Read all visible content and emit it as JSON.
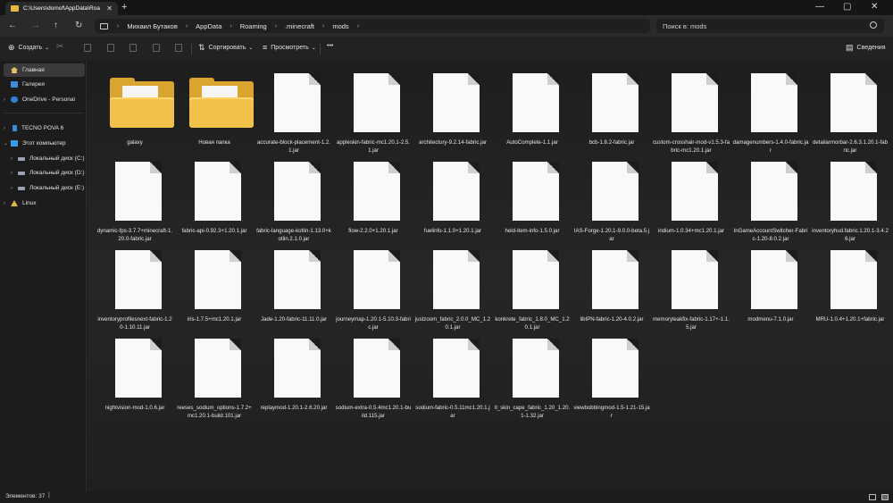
{
  "window": {
    "tab_title": "C:\\Users\\domof\\AppData\\Roa",
    "controls": {
      "minimize": "—",
      "maximize": "▢",
      "close": "✕"
    }
  },
  "address": {
    "breadcrumb": [
      "Михаил Бутаков",
      "AppData",
      "Roaming",
      ".minecraft",
      "mods"
    ],
    "search_placeholder": "Поиск в: mods"
  },
  "toolbar": {
    "create_label": "Создать",
    "sort_label": "Сортировать",
    "view_label": "Просмотреть",
    "more_label": "•••",
    "details_label": "Сведения"
  },
  "sidebar": {
    "items": [
      {
        "label": "Главная",
        "icon": "home-icon",
        "selected": true
      },
      {
        "label": "Галерея",
        "icon": "gallery-icon",
        "selected": false
      },
      {
        "label": "OneDrive - Personal",
        "icon": "cloud-icon",
        "selected": false
      },
      {
        "label": "TECNO POVA 6",
        "icon": "phone-icon",
        "selected": false
      },
      {
        "label": "Этот компьютер",
        "icon": "computer-icon",
        "selected": false
      },
      {
        "label": "Локальный диск (C:)",
        "icon": "drive-icon",
        "selected": false
      },
      {
        "label": "Локальный диск (D:)",
        "icon": "drive-icon",
        "selected": false
      },
      {
        "label": "Локальный диск (E:)",
        "icon": "drive-icon",
        "selected": false
      },
      {
        "label": "Linux",
        "icon": "linux-icon",
        "selected": false
      }
    ]
  },
  "files": [
    {
      "name": "galaxy",
      "type": "folder"
    },
    {
      "name": "Новая папка",
      "type": "folder"
    },
    {
      "name": "accurate-block-placement-1.2.1.jar",
      "type": "file"
    },
    {
      "name": "appleskin-fabric-mc1.20.1-2.5.1.jar",
      "type": "file"
    },
    {
      "name": "architectury-9.2.14-fabric.jar",
      "type": "file"
    },
    {
      "name": "AutoComplete-1.1.jar",
      "type": "file"
    },
    {
      "name": "bcb-1.8.2-fabric.jar",
      "type": "file"
    },
    {
      "name": "custom-crosshair-mod-v1.5.3-fabric-mc1.20.1.jar",
      "type": "file"
    },
    {
      "name": "damagenumbers-1.4.0-fabric.jar",
      "type": "file"
    },
    {
      "name": "detailarmorbar-2.6.3.1.20.1-fabric.jar",
      "type": "file"
    },
    {
      "name": "dynamic-fps-3.7.7+minecraft-1.20.0-fabric.jar",
      "type": "file"
    },
    {
      "name": "fabric-api-0.92.3+1.20.1.jar",
      "type": "file"
    },
    {
      "name": "fabric-language-kotlin-1.13.0+kotlin.2.1.0.jar",
      "type": "file"
    },
    {
      "name": "flow-2.2.0+1.20.1.jar",
      "type": "file"
    },
    {
      "name": "fuelinfo-1.1.0+1.20.1.jar",
      "type": "file"
    },
    {
      "name": "held-item-info-1.5.0.jar",
      "type": "file"
    },
    {
      "name": "IAS-Forge-1.20.1-9.0.0-beta.5.jar",
      "type": "file"
    },
    {
      "name": "indium-1.0.34+mc1.20.1.jar",
      "type": "file"
    },
    {
      "name": "InGameAccountSwitcher-Fabric-1.20-8.0.2.jar",
      "type": "file"
    },
    {
      "name": "inventoryhud.fabric.1.20.1-3.4.26.jar",
      "type": "file"
    },
    {
      "name": "inventoryprofilesnext-fabric-1.20-1.10.11.jar",
      "type": "file"
    },
    {
      "name": "iris-1.7.5+mc1.20.1.jar",
      "type": "file"
    },
    {
      "name": "Jade-1.20-fabric-11.11.0.jar",
      "type": "file"
    },
    {
      "name": "journeymap-1.20.1-5.10.3-fabric.jar",
      "type": "file"
    },
    {
      "name": "justzoom_fabric_2.0.0_MC_1.20.1.jar",
      "type": "file"
    },
    {
      "name": "konkrete_fabric_1.8.0_MC_1.20.1.jar",
      "type": "file"
    },
    {
      "name": "libIPN-fabric-1.20-4.0.2.jar",
      "type": "file"
    },
    {
      "name": "memoryleakfix-fabric-1.17+-1.1.5.jar",
      "type": "file"
    },
    {
      "name": "modmenu-7.1.0.jar",
      "type": "file"
    },
    {
      "name": "MRU-1.0.4+1.20.1+fabric.jar",
      "type": "file"
    },
    {
      "name": "nightvision-mod-1.0.6.jar",
      "type": "file"
    },
    {
      "name": "reeses_sodium_options-1.7.2+mc1.20.1-build.101.jar",
      "type": "file"
    },
    {
      "name": "replaymod-1.20.1-2.6.20.jar",
      "type": "file"
    },
    {
      "name": "sodium-extra-0.5.4mc1.20.1-build.115.jar",
      "type": "file"
    },
    {
      "name": "sodium-fabric-0.5.11mc1.20.1.jar",
      "type": "file"
    },
    {
      "name": "tl_skin_cape_fabric_1.20_1.20.1-1.32.jar",
      "type": "file"
    },
    {
      "name": "viewbobbingmod-1.5-1.21-15.jar",
      "type": "file"
    }
  ],
  "status": {
    "count_text": "Элементов: 37"
  }
}
